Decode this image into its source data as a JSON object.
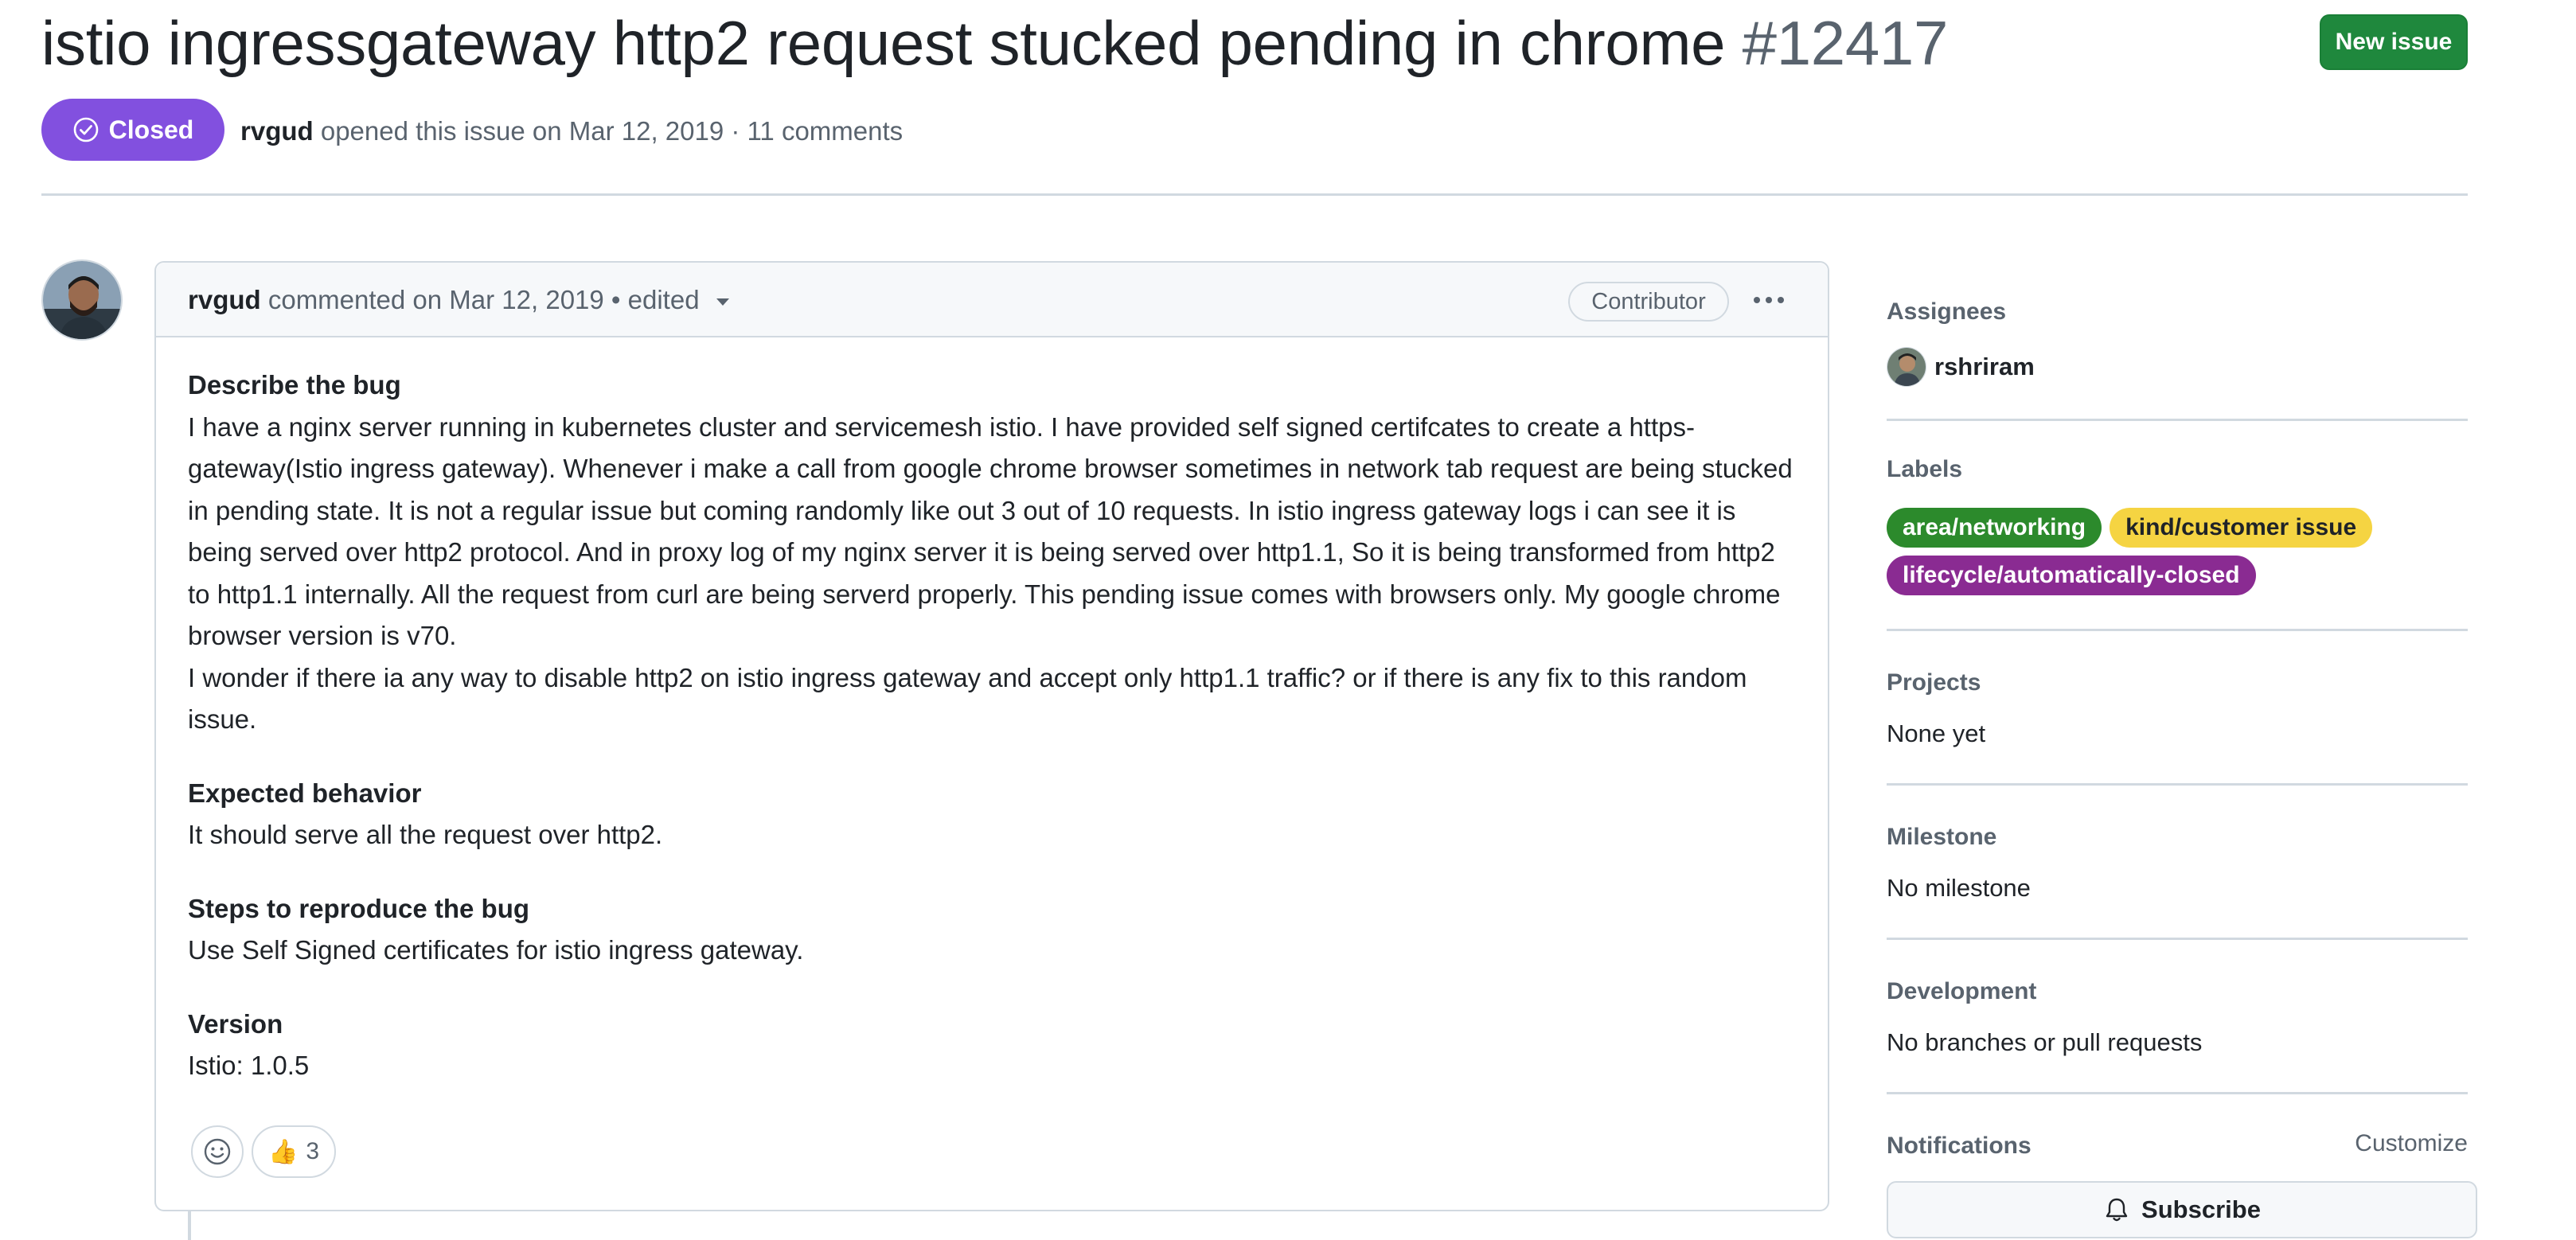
{
  "issue": {
    "title": "istio ingressgateway http2 request stucked pending in chrome",
    "number": "#12417",
    "state": "Closed",
    "author": "rvgud",
    "opened_text": "opened this issue on Mar 12, 2019 · 11 comments"
  },
  "header": {
    "new_issue_label": "New issue"
  },
  "comment": {
    "author": "rvgud",
    "meta_text": "commented on Mar 12, 2019 • edited",
    "role_badge": "Contributor",
    "sections": [
      {
        "heading": "Describe the bug",
        "paragraphs": [
          "I have a nginx server running in kubernetes cluster and servicemesh istio. I have provided self signed certifcates to create a https-gateway(Istio ingress gateway). Whenever i make a call from google chrome browser sometimes in network tab request are being stucked in pending state. It is not a regular issue but coming randomly like out 3 out of 10 requests. In istio ingress gateway logs i can see it is being served over http2 protocol. And in proxy log of my nginx server it is being served over http1.1, So it is being transformed from http2 to http1.1 internally. All the request from curl are being serverd properly. This pending issue comes with browsers only. My google chrome browser version is v70.",
          "I wonder if there ia any way to disable http2 on istio ingress gateway and accept only http1.1 traffic? or if there is any fix to this random issue."
        ]
      },
      {
        "heading": "Expected behavior",
        "paragraphs": [
          "It should serve all the request over http2."
        ]
      },
      {
        "heading": "Steps to reproduce the bug",
        "paragraphs": [
          "Use Self Signed certificates for istio ingress gateway."
        ]
      },
      {
        "heading": "Version",
        "paragraphs": [
          "Istio: 1.0.5"
        ]
      }
    ],
    "reactions": {
      "thumbs_up_emoji": "👍",
      "thumbs_up_count": "3"
    }
  },
  "sidebar": {
    "assignees": {
      "heading": "Assignees",
      "name": "rshriram"
    },
    "labels": {
      "heading": "Labels",
      "items": [
        {
          "text": "area/networking",
          "bg": "#2c8a2c",
          "fg": "#ffffff"
        },
        {
          "text": "kind/customer issue",
          "bg": "#f5d442",
          "fg": "#1f2328"
        },
        {
          "text": "lifecycle/automatically-closed",
          "bg": "#8a2b92",
          "fg": "#ffffff"
        }
      ]
    },
    "projects": {
      "heading": "Projects",
      "value": "None yet"
    },
    "milestone": {
      "heading": "Milestone",
      "value": "No milestone"
    },
    "development": {
      "heading": "Development",
      "value": "No branches or pull requests"
    },
    "notifications": {
      "heading": "Notifications",
      "customize": "Customize",
      "subscribe_label": "Subscribe"
    }
  },
  "colors": {
    "closed_purple": "#8250df",
    "new_issue_green": "#1f883d",
    "border": "#d1d9e0",
    "muted_text": "#59636e"
  }
}
